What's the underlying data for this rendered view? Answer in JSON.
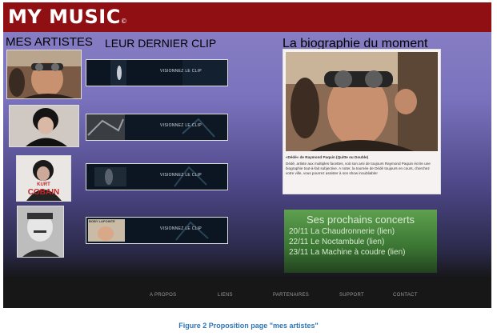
{
  "header": {
    "logo": "MY MUSIC",
    "logo_mark": "©"
  },
  "artists": {
    "title": "MES ARTISTES",
    "items": [
      {
        "icon": "artist-portrait-goggles"
      },
      {
        "icon": "artist-portrait-dark-hair"
      },
      {
        "icon": "artist-portrait-kurt-cobain",
        "caption_line1": "KURT",
        "caption_line2": "COBAIN"
      },
      {
        "icon": "artist-portrait-bw-man"
      }
    ]
  },
  "clips": {
    "title": "LEUR DERNIER CLIP",
    "items": [
      {
        "label": "VISIONNEZ LE CLIP"
      },
      {
        "label": "VISIONNEZ LE CLIP"
      },
      {
        "label": "VISIONNEZ LE CLIP"
      },
      {
        "label": "VISIONNEZ LE CLIP",
        "thumb_text": "BOBY LAPOINTE"
      }
    ]
  },
  "biography": {
    "title": "La biographie du moment",
    "caption": "«Dédé» de Raymond Paquin (Quitte ou Double)",
    "text": "Dédé, artiste aux multiples facettes, voit son ami de toujours Raymond Paquin écrire une biographie tout-à-fait subjective. A noter, la tournée de Dédé toujours en cours, cherchez votre ville, vous pourrez assister à son show inoubliable!"
  },
  "concerts": {
    "title": "Ses prochains concerts",
    "items": [
      "20/11 La Chaudronnerie (lien)",
      "22/11 Le Noctambule (lien)",
      "23/11 La Machine à coudre (lien)"
    ]
  },
  "footer": {
    "links": [
      "A PROPOS",
      "LIENS",
      "PARTENAIRES",
      "SUPPORT",
      "CONTACT"
    ]
  },
  "figure_caption": "Figure 2 Proposition page \"mes artistes\"",
  "colors": {
    "header": "#8f0f13",
    "concerts_box": "#4a8a3f",
    "caption": "#2e75b6"
  }
}
